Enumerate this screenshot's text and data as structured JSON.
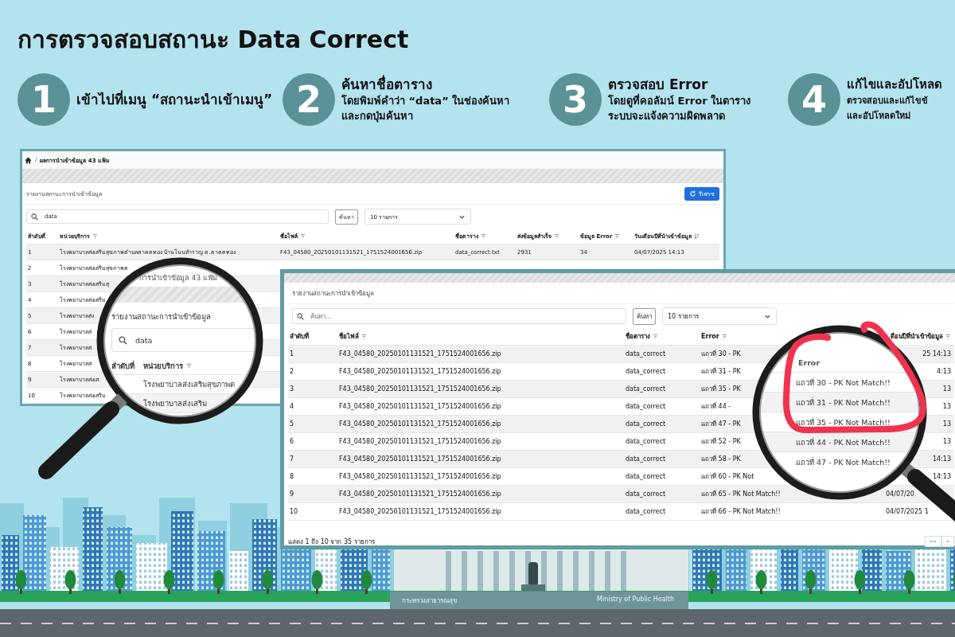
{
  "title": "การตรวจสอบสถานะ Data Correct",
  "steps": [
    {
      "number": "1",
      "heading": "เข้าไปที่เมนู “สถานะนำเข้าเมนู”"
    },
    {
      "number": "2",
      "heading": "ค้นหาชื่อตาราง",
      "text": [
        "โดยพิมพ์คำว่า “data” ในช่องค้นหา",
        "และกดปุ่มค้นหา"
      ]
    },
    {
      "number": "3",
      "heading": "ตรวจสอบ Error",
      "text": [
        "โดยดูที่คอลัมน์ Error ในตาราง",
        "ระบบจะแจ้งความผิดพลาด"
      ]
    },
    {
      "number": "4",
      "heading": "แก้ไขและอัปโหลด",
      "text": [
        "ตรวจสอบและแก้ไขข้",
        "และอัปโหลดใหม่"
      ]
    }
  ],
  "screen_1": {
    "breadcrumb_separator": "/",
    "breadcrumb": "ผลการนำเข้าข้อมูล 43 แฟ้ม",
    "panel_title": "รายงานสถานะการนำเข้าข้อมูล",
    "refresh_button": "รีเฟรช",
    "search": {
      "value": "data"
    },
    "search_button": "ค้นหา",
    "page_size": "10 รายการ",
    "columns": [
      {
        "label": "ลำดับที่"
      },
      {
        "label": "หน่วยบริการ",
        "filter": true
      },
      {
        "label": "ชื่อไฟล์",
        "filter": true
      },
      {
        "label": "ชื่อตาราง",
        "filter": true
      },
      {
        "label": "ส่งข้อมูลสำเร็จ",
        "filter": true
      },
      {
        "label": "ข้อมูล Error",
        "filter": true
      },
      {
        "label": "วันเดือนปีที่นำเข้าข้อมูล",
        "sorted": true
      }
    ],
    "rows": [
      [
        "1",
        "โรงพยาบาลส่งเสริมสุขภาพตำบลตาคตทอง บ้านโนนสำราญ ต.ตาคตทอง",
        "F43_04580_20250101131521_1751524001656.zip",
        "data_correct.txt",
        "2931",
        "34",
        "04/07/2025 14:13"
      ],
      [
        "2",
        "โรงพยาบาลส่งเสริมสุขภาพต"
      ],
      [
        "3",
        "โรงพยาบาลส่งเสริมสุ"
      ],
      [
        "4",
        "โรงพยาบาลส่งเสริม"
      ],
      [
        "5",
        "โรงพยาบาลส่ง"
      ],
      [
        "6",
        "โรงพยาบาลส่"
      ],
      [
        "7",
        "โรงพยาบาลส่"
      ],
      [
        "8",
        "โรงพยาบาลส่"
      ],
      [
        "9",
        "โรงพยาบาลส่งเส"
      ],
      [
        "10",
        "โรงพยาบาลส่งเสริม"
      ]
    ]
  },
  "magnifier_1": {
    "breadcrumb": "การนำเข้าข้อมูล 43 แฟ้ม",
    "panel_title": "รายงานสถานะการนำเข้าข้อมูล",
    "search_value": "data",
    "columns": [
      "ลำดับที่",
      "หน่วยบริการ"
    ],
    "rows": [
      "โรงพยาบาลส่งเสริมสุขภาพต",
      "โรงพยาบาลส่งเสริม"
    ]
  },
  "screen_2": {
    "panel_title": "รายงานสถานะการนำเข้าข้อมูล",
    "search": {
      "placeholder": "ค้นหา..."
    },
    "search_button": "ค้นหา",
    "page_size": "10 รายการ",
    "columns": [
      {
        "label": "ลำดับที่"
      },
      {
        "label": "ชื่อไฟล์",
        "filter": true
      },
      {
        "label": "ชื่อตาราง",
        "filter": true
      },
      {
        "label": "Error",
        "filter": true
      },
      {
        "label": "ดือนปีที่นำเข้าข้อมูล",
        "filter": true
      }
    ],
    "rows": [
      [
        "1",
        "F43_04580_20250101131521_1751524001656.zip",
        "data_correct",
        "แถวที่ 30 - PK",
        "25 14:13"
      ],
      [
        "2",
        "F43_04580_20250101131521_1751524001656.zip",
        "data_correct",
        "แถวที่ 31 - PK",
        "4:13"
      ],
      [
        "3",
        "F43_04580_20250101131521_1751524001656.zip",
        "data_correct",
        "แถวที่ 35 - PK",
        "13"
      ],
      [
        "4",
        "F43_04580_20250101131521_1751524001656.zip",
        "data_correct",
        "แถวที่ 44 -",
        "13"
      ],
      [
        "5",
        "F43_04580_20250101131521_1751524001656.zip",
        "data_correct",
        "แถวที่ 47 - PK",
        "13"
      ],
      [
        "6",
        "F43_04580_20250101131521_1751524001656.zip",
        "data_correct",
        "แถวที่ 52 - PK",
        "13"
      ],
      [
        "7",
        "F43_04580_20250101131521_1751524001656.zip",
        "data_correct",
        "แถวที่ 58 - PK",
        "14:13"
      ],
      [
        "8",
        "F43_04580_20250101131521_1751524001656.zip",
        "data_correct",
        "แถวที่ 60 - PK Not",
        "14:13"
      ],
      [
        "9",
        "F43_04580_20250101131521_1751524001656.zip",
        "data_correct",
        "แถวที่ 65 - PK Not Match!!",
        "04/07/20"
      ],
      [
        "10",
        "F43_04580_20250101131521_1751524001656.zip",
        "data_correct",
        "แถวที่ 66 - PK Not Match!!",
        "04/07/2025 1"
      ]
    ],
    "footer": "แสดง 1 ถึง 10 จาก 35 รายการ",
    "pager": [
      "««",
      "«"
    ]
  },
  "magnifier_2": {
    "column": "Error",
    "rows": [
      "แถวที่ 30 - PK Not Match!!",
      "แถวที่ 31 - PK Not Match!!",
      "แถวที่ 35 - PK Not Match!!",
      "แถวที่ 44 - PK Not Match!!",
      "แถวที่ 47 - PK Not Match!!"
    ]
  },
  "city": {
    "signs": [
      "กระทรวงสาธารณสุข",
      "Ministry of Public Health"
    ]
  }
}
